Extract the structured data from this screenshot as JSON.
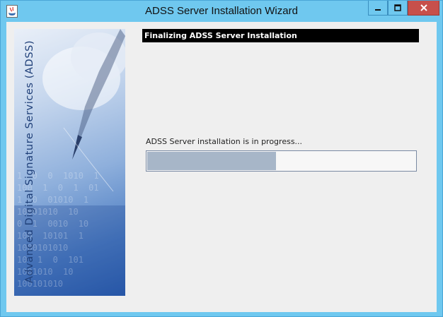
{
  "window": {
    "title": "ADSS Server Installation Wizard",
    "app_icon": "java-icon",
    "controls": {
      "minimize_icon": "minimize-icon",
      "maximize_icon": "maximize-icon",
      "close_icon": "close-icon"
    },
    "colors": {
      "titlebar": "#6fc8ef",
      "close_button": "#c7504b"
    }
  },
  "banner": {
    "text": "Advanced Digital Signature Services (ADSS)"
  },
  "step": {
    "header": "Finalizing ADSS Server Installation",
    "status": "ADSS Server installation is in progress...",
    "progress_fraction": 0.48
  }
}
